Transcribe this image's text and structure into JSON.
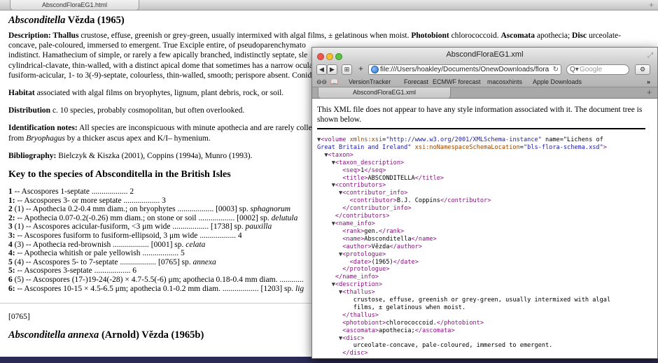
{
  "browser": {
    "back_tab_title": "AbscondFloraEG1.html",
    "new_tab": "+"
  },
  "html_page": {
    "heading_genus": "Absconditella",
    "heading_author": "Vězda (1965)",
    "description": [
      {
        "b": "Description: "
      },
      {
        "b": "Thallus"
      },
      {
        "t": " crustose, effuse, greenish or grey-green, usually intermixed with algal films, ± gelatinous when moist. "
      },
      {
        "b": "Photobiont"
      },
      {
        "t": " chlorococcoid. "
      },
      {
        "b": "Ascomata"
      },
      {
        "t": " apothecia; "
      },
      {
        "b": "Disc"
      },
      {
        "t": " urceolate-concave, pale-coloured, immersed to emergent. "
      },
      {
        "b": "True Exciple"
      },
      {
        "t": " entire, of pseudoparenchymato"
      },
      {
        "t": "us hyphae, ... cylindrical-clavate, thin-walled, with a distinct apical dome... indistinct. "
      },
      {
        "b": "Hamathecium"
      },
      {
        "t": " of simple, or rarely a few apically branched, indistinctly septate, sle"
      },
      {
        "t": "nder ... cylindrical-clavate, thin-walled, with a distinct apical dome that sometimes has a narrow ocula"
      },
      {
        "t": " ... fusiform-acicular, 1- to 3(-9)-septate, colourless, thin-walled, smooth; perispore absent. "
      },
      {
        "b": "Conid"
      }
    ],
    "desc_lines": [
      "concave, pale-coloured, immersed to emergent. True Exciple entire, of pseudoparenchymato",
      "indistinct. Hamathecium of simple, or rarely a few apically branched, indistinctly septate, sle",
      "cylindrical-clavate, thin-walled, with a distinct apical dome that sometimes has a narrow ocula",
      "fusiform-acicular, 1- to 3(-9)-septate, colourless, thin-walled, smooth; perispore absent. Conid"
    ],
    "habitat_label": "Habitat",
    "habitat_text": " associated with algal films on bryophytes, lignum, plant debris, rock, or soil.",
    "distribution_label": "Distribution",
    "distribution_text": " c. 10 species, probably cosmopolitan, but often overlooked.",
    "idnotes_label": "Identification notes:",
    "idnotes_text1": " All species are inconspicuous with minute apothecia and are rarely colle",
    "idnotes_text2a": "from ",
    "idnotes_text2b": "Bryophagus",
    "idnotes_text2c": " by a thicker ascus apex and K/I– hymenium.",
    "biblio_label": "Bibliography:",
    "biblio_text": " Bielczyk & Kiszka (2001), Coppins (1994a), Munro (1993).",
    "key_heading": "Key to the species of Absconditella in the British Isles",
    "key_lines": [
      {
        "n": "1",
        "t": " -- Ascospores 1-septate .................. 2"
      },
      {
        "n": "1:",
        "t": " -- Ascospores 3- or more septate .................. 3"
      },
      {
        "n": "2",
        "t": " (1) -- Apothecia 0.2-0.4 mm diam.; on bryophytes .................. [0003] sp. ",
        "i": "sphagnorum"
      },
      {
        "n": "2:",
        "t": " -- Apothecia 0.07-0.2(-0.26) mm diam.; on stone or soil .................. [0002] sp. ",
        "i": "delutula"
      },
      {
        "n": "3",
        "t": " (1) -- Ascospores acicular-fusiform, <3 μm wide .................. [1738] sp. ",
        "i": "pauxilla"
      },
      {
        "n": "3:",
        "t": " -- Ascospores fusiform to fusiform-ellipsoid, 3 μm wide .................. 4"
      },
      {
        "n": "4",
        "t": " (3) -- Apothecia red-brownish .................. [0001] sp. ",
        "i": "celata"
      },
      {
        "n": "4:",
        "t": " -- Apothecia whitish or pale yellowish .................. 5"
      },
      {
        "n": "5",
        "t": " (4) -- Ascospores 5- to 7-septate .................. [0765] sp. ",
        "i": "annexa"
      },
      {
        "n": "5:",
        "t": " -- Ascospores 3-septate .................. 6"
      },
      {
        "n": "6",
        "t": " (5) -- Ascospores (17-)19-24(-28) × 4.7-5.5(-6) μm; apothecia 0.18-0.4 mm diam. ............"
      },
      {
        "n": "6:",
        "t": " -- Ascospores 10-15 × 4.5-6.5 μm; apothecia 0.1-0.2 mm diam. .................. [1203] sp. ",
        "i": "lig"
      }
    ],
    "record_id": "[0765]",
    "next_heading_genus": "Absconditella annexa",
    "next_heading_rest": " (Arnold) Vězda (1965b)"
  },
  "xml_window": {
    "title": "AbscondFloraEG1.xml",
    "url": "file:///Users/hoakley/Documents/OnewDownloads/flora",
    "search_placeholder": "Google",
    "bookmarks": [
      "VersionTracker",
      "Forecast",
      "ECMWF forecast",
      "macosxhints",
      "Apple Downloads"
    ],
    "tab_title": "AbscondFloraEG1.xml",
    "notice": "This XML file does not appear to have any style information associated with it. The document tree is shown below.",
    "tree": [
      {
        "d": 0,
        "tri": "▼",
        "h": "<volume xmlns:xsi=\"http://www.w3.org/2001/XMLSchema-instance\" name=\"Lichens of",
        "k": "open"
      },
      {
        "d": 0,
        "tri": "",
        "h": "Great Britain and Ireland\" xsi:noNamespaceSchemaLocation=\"bls-flora-schema.xsd\">",
        "k": "cont"
      },
      {
        "d": 1,
        "tri": "▼",
        "h": "<taxon>",
        "k": "tag"
      },
      {
        "d": 2,
        "tri": "▼",
        "h": "<taxon_description>",
        "k": "tag"
      },
      {
        "d": 3,
        "tri": "",
        "h": "<seq>",
        "txt": "1",
        "c": "</seq>",
        "k": "inline"
      },
      {
        "d": 3,
        "tri": "",
        "h": "<title>",
        "txt": "ABSCONDITELLA",
        "c": "</title>",
        "k": "inline"
      },
      {
        "d": 2,
        "tri": "▼",
        "h": "<contributors>",
        "k": "tag"
      },
      {
        "d": 3,
        "tri": "▼",
        "h": "<contributor_info>",
        "k": "tag"
      },
      {
        "d": 4,
        "tri": "",
        "h": "<contributor>",
        "txt": "B.J. Coppins",
        "c": "</contributor>",
        "k": "inline"
      },
      {
        "d": 3,
        "tri": "",
        "h": "</contributor_info>",
        "k": "tag"
      },
      {
        "d": 2,
        "tri": "",
        "h": "</contributors>",
        "k": "tag"
      },
      {
        "d": 2,
        "tri": "▼",
        "h": "<name_info>",
        "k": "tag"
      },
      {
        "d": 3,
        "tri": "",
        "h": "<rank>",
        "txt": "gen.",
        "c": "</rank>",
        "k": "inline"
      },
      {
        "d": 3,
        "tri": "",
        "h": "<name>",
        "txt": "Absconditella",
        "c": "</name>",
        "k": "inline"
      },
      {
        "d": 3,
        "tri": "",
        "h": "<author>",
        "txt": "Vězda",
        "c": "</author>",
        "k": "inline"
      },
      {
        "d": 3,
        "tri": "▼",
        "h": "<protologue>",
        "k": "tag"
      },
      {
        "d": 4,
        "tri": "",
        "h": "<date>",
        "txt": "(1965)",
        "c": "</date>",
        "k": "inline"
      },
      {
        "d": 3,
        "tri": "",
        "h": "</protologue>",
        "k": "tag"
      },
      {
        "d": 2,
        "tri": "",
        "h": "</name_info>",
        "k": "tag"
      },
      {
        "d": 2,
        "tri": "▼",
        "h": "<description>",
        "k": "tag"
      },
      {
        "d": 3,
        "tri": "▼",
        "h": "<thallus>",
        "k": "tag"
      },
      {
        "d": 4,
        "tri": "",
        "h": "crustose, effuse, greenish or grey-green, usually intermixed with algal",
        "k": "text"
      },
      {
        "d": 4,
        "tri": "",
        "h": "films, ± gelatinous when moist.",
        "k": "text"
      },
      {
        "d": 3,
        "tri": "",
        "h": "</thallus>",
        "k": "tag"
      },
      {
        "d": 3,
        "tri": "",
        "h": "<photobiont>",
        "txt": "chlorococcoid.",
        "c": "</photobiont>",
        "k": "inline"
      },
      {
        "d": 3,
        "tri": "",
        "h": "<ascomata>",
        "txt": "apothecia;",
        "c": "</ascomata>",
        "k": "inline"
      },
      {
        "d": 3,
        "tri": "▼",
        "h": "<disc>",
        "k": "tag"
      },
      {
        "d": 4,
        "tri": "",
        "h": "urceolate-concave, pale-coloured, immersed to emergent.",
        "k": "text"
      },
      {
        "d": 3,
        "tri": "",
        "h": "</disc>",
        "k": "tag"
      }
    ]
  }
}
